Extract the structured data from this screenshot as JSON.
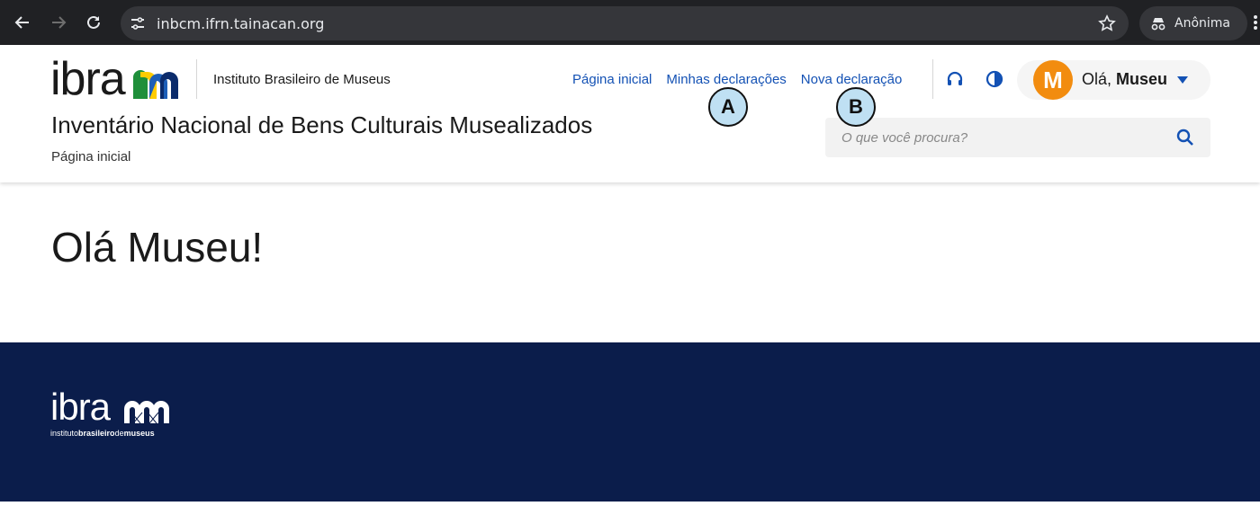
{
  "browser": {
    "url": "inbcm.ifrn.tainacan.org",
    "incognito_label": "Anônima"
  },
  "header": {
    "logo_text": "ibra",
    "org_name": "Instituto Brasileiro de Museus",
    "site_title": "Inventário Nacional de Bens Culturais Musealizados",
    "breadcrumb": "Página inicial",
    "nav": {
      "home": "Página inicial",
      "my_declarations": "Minhas declarações",
      "new_declaration": "Nova declaração"
    },
    "user": {
      "avatar_letter": "M",
      "greeting_prefix": "Olá,",
      "name": "Museu"
    },
    "search": {
      "placeholder": "O que você procura?"
    }
  },
  "markers": {
    "a": "A",
    "b": "B"
  },
  "main": {
    "heading": "Olá Museu!"
  },
  "footer": {
    "logo_text": "ibra",
    "sub_light_1": "instituto",
    "sub_bold_1": "brasileiro",
    "sub_light_2": "de",
    "sub_bold_2": "museus"
  },
  "colors": {
    "link": "#1351b4",
    "footer_bg": "#0b1d4b",
    "avatar": "#f28c0f",
    "browser_bg": "#202124"
  }
}
